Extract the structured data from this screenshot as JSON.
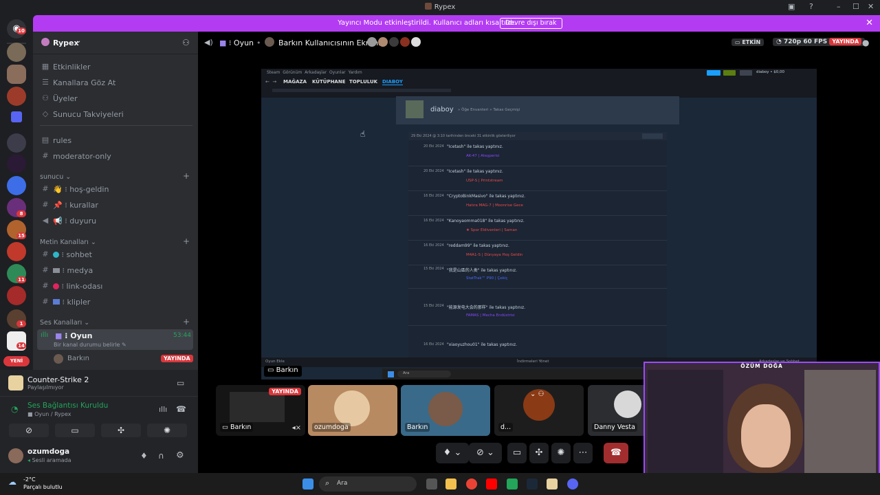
{
  "window": {
    "title": "Rypex"
  },
  "banner": {
    "text": "Yayıncı Modu etkinleştirildi. Kullanıcı adları kısaltıldı.",
    "button": "Devre dışı bırak"
  },
  "servers": {
    "badges": [
      "10",
      "8",
      "15",
      "11",
      "1",
      "14"
    ],
    "new_label": "YENİ"
  },
  "guild": {
    "name": "Rypex"
  },
  "sidebar": {
    "top_items": [
      {
        "label": "Etkinlikler"
      },
      {
        "label": "Kanallara Göz At"
      },
      {
        "label": "Üyeler"
      },
      {
        "label": "Sunucu Takviyeleri"
      }
    ],
    "plain_channels": [
      {
        "label": "rules"
      },
      {
        "label": "moderator-only"
      }
    ],
    "cat_sunucu": "sunucu",
    "sunucu_channels": [
      {
        "label": "hoş-geldin",
        "emoji": "👋"
      },
      {
        "label": "kurallar",
        "emoji": "📌"
      },
      {
        "label": "duyuru",
        "emoji": "📢"
      }
    ],
    "cat_metin": "Metin Kanalları",
    "metin_channels": [
      {
        "label": "sohbet"
      },
      {
        "label": "medya"
      },
      {
        "label": "link-odası"
      },
      {
        "label": "klipler"
      }
    ],
    "cat_ses": "Ses Kanalları",
    "voice_channel": {
      "label": "Oyun",
      "timer": "53:44",
      "status": "Bir kanal durumu belirle"
    },
    "voice_user": {
      "name": "Barkın",
      "badge": "YAYINDA"
    }
  },
  "panel": {
    "game": {
      "title": "Counter-Strike 2",
      "sub": "Paylaşılmıyor"
    },
    "voice": {
      "title": "Ses Bağlantısı Kuruldu",
      "sub": "Oyun / Rypex"
    },
    "user": {
      "name": "ozumdoga",
      "status": "Sesli aramada"
    }
  },
  "stage": {
    "channel": "Oyun",
    "stream_title": "Barkın Kullanıcısının Ekranı",
    "badge_active": "ETKİN",
    "quality": "720p 60 FPS",
    "live": "YAYINDA",
    "presenter": "Barkın"
  },
  "steam": {
    "menu": [
      "Steam",
      "Görünüm",
      "Arkadaşlar",
      "Oyunlar",
      "Yardım"
    ],
    "tabs": [
      "MAĞAZA",
      "KÜTÜPHANE",
      "TOPLULUK",
      "DIABOY"
    ],
    "profile_name": "diaboy",
    "breadcrumb": "» Öğe Envanteri » Takas Geçmişi",
    "list_header": "29 Eki 2024 @ 3:10 tarihinden önceki 31 etkinlik gösteriliyor",
    "trades": [
      {
        "date": "20 Eki 2024",
        "partner": "\"Icetash\" ile takas yaptınız.",
        "item": "AK-47 | Ateşperisi"
      },
      {
        "date": "20 Eki 2024",
        "partner": "\"Icetash\" ile takas yaptınız.",
        "item": "USP-S | Printstream"
      },
      {
        "date": "16 Eki 2024",
        "partner": "\"CryptoBinkMasivo\" ile takas yaptınız.",
        "item": "Hatıra MAG-7 | Moonrise Gece"
      },
      {
        "date": "16 Eki 2024",
        "partner": "\"Kanoyaomma018\" ile takas yaptınız.",
        "item": "★ Spor Eldivenleri | Saman"
      },
      {
        "date": "16 Eki 2024",
        "partner": "\"reddam99\" ile takas yaptınız.",
        "item": "M4A1-S | Dünyaya Hoş Geldin"
      },
      {
        "date": "15 Eki 2024",
        "partner": "\"我是山區的人类\" ile takas yaptınız.",
        "item": "StatTrak™ P90 | Çekiç"
      },
      {
        "date": "15 Eki 2024",
        "partner": "\"能源发电大会的那样\" ile takas yaptınız.",
        "item": "FAMAS | Mecha Endüstrisi"
      },
      {
        "date": "16 Eki 2024",
        "partner": "\"xiaoyuzhou01\" ile takas yaptınız.",
        "item": ""
      }
    ],
    "footer_left": "Oyun Ekle",
    "footer_mid": "İndirmeleri Yönet",
    "footer_right": "Arkadaşlar ve Sohbet",
    "wallet": "diaboy • $0,00"
  },
  "tiles": [
    {
      "name": "Barkın",
      "live": "YAYINDA"
    },
    {
      "name": "ozumdoga"
    },
    {
      "name": "Barkın"
    },
    {
      "name": "d..."
    },
    {
      "name": "Danny Vesta"
    }
  ],
  "camera": {
    "label": "ÖZÜM DOĞA"
  },
  "taskbar": {
    "search": "Ara",
    "weather_temp": "-2°C",
    "weather_desc": "Parçalı bulutlu",
    "inner_search": "Ara"
  }
}
